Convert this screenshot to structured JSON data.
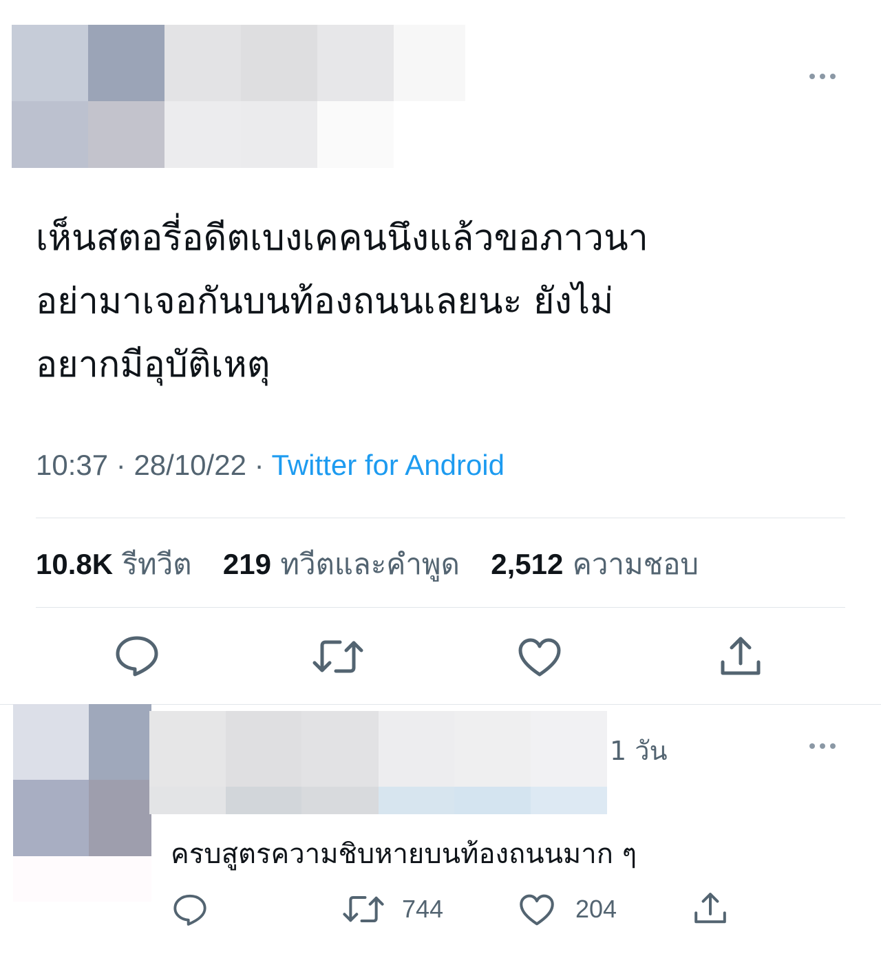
{
  "tweet": {
    "text_line1": "เห็นสตอรี่อดีตเบงเคคนนึงแล้วขอภาวนา",
    "text_line2": "อย่ามาเจอกันบนท้องถนนเลยนะ ยังไม่",
    "text_line3": "อยากมีอุบัติเหตุ",
    "time": "10:37",
    "separator": " · ",
    "date": "28/10/22",
    "source": "Twitter for Android"
  },
  "stats": {
    "retweets_count": "10.8K",
    "retweets_label": "รีทวีต",
    "quotes_count": "219",
    "quotes_label": "ทวีตและคำพูด",
    "likes_count": "2,512",
    "likes_label": "ความชอบ"
  },
  "reply": {
    "time": "1 วัน",
    "text": "ครบสูตรความชิบหายบนท้องถนนมาก ๆ",
    "retweet_count": "744",
    "like_count": "204"
  },
  "icons": {
    "more": "more-horizontal-icon",
    "reply": "reply-bubble-icon",
    "retweet": "retweet-icon",
    "like": "heart-icon",
    "share": "share-upload-icon"
  },
  "colors": {
    "text": "#0f1419",
    "secondary": "#536471",
    "link": "#1d9bf0",
    "divider": "#e1e6ea"
  }
}
